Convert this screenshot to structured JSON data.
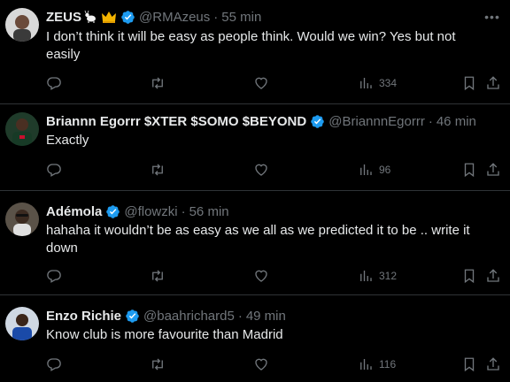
{
  "tweets": [
    {
      "name": "ZEUS",
      "emojis": [
        "goat-emoji",
        "crown-emoji"
      ],
      "handle": "@RMAzeus",
      "time": "55 min",
      "text": "I don’t think it will be easy as people think. Would we win? Yes but not easily",
      "views": "334"
    },
    {
      "name": "Briannn Egorrr $XTER $SOMO $BEYOND",
      "handle": "@BriannnEgorrr",
      "time": "46 min",
      "text": "Exactly",
      "views": "96"
    },
    {
      "name": "Adémola",
      "handle": "@flowzki",
      "time": "56 min",
      "text": "hahaha it wouldn’t be as easy as we all as we predicted it to be .. write it down",
      "views": "312"
    },
    {
      "name": "Enzo Richie",
      "handle": "@baahrichard5",
      "time": "49 min",
      "text": "Know club is more favourite than Madrid",
      "views": "116"
    }
  ],
  "colors": {
    "background": "#000000",
    "text": "#e7e9ea",
    "muted": "#71767b",
    "verified": "#1d9bf0",
    "divider": "#2f3336"
  }
}
